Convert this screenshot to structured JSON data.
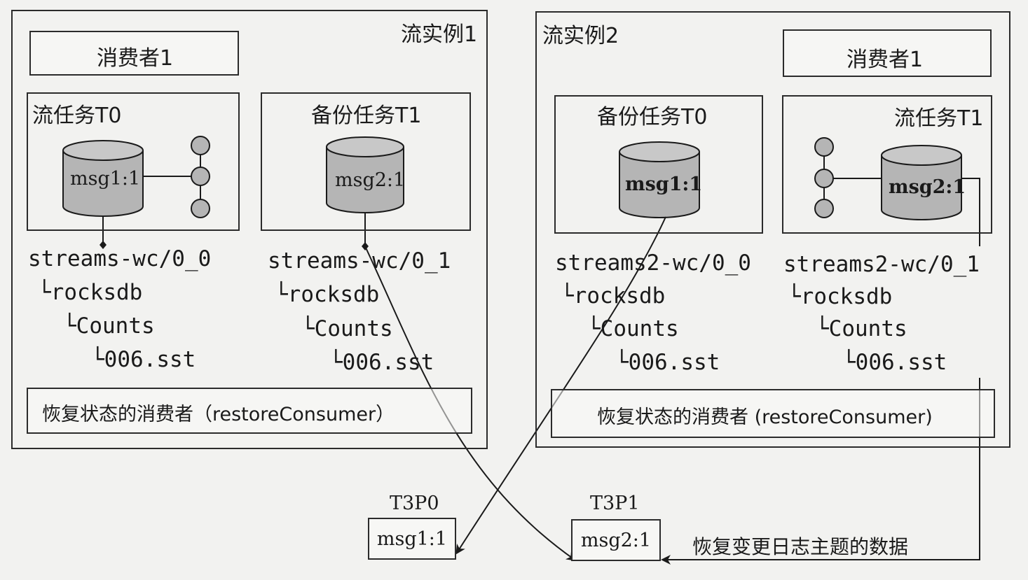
{
  "instance1": {
    "title": "流实例1",
    "consumer": "消费者1",
    "task_a": {
      "title": "流任务T0",
      "store": "msg1:1"
    },
    "task_b": {
      "title": "备份任务T1",
      "store": "msg2:1"
    },
    "dir_a": [
      "streams-wc/0_0",
      "└rocksdb",
      "└Counts",
      "└006.sst"
    ],
    "dir_b": [
      "streams-wc/0_1",
      "└rocksdb",
      "└Counts",
      "└006.sst"
    ],
    "restore": "恢复状态的消费者（restoreConsumer）"
  },
  "instance2": {
    "title": "流实例2",
    "consumer": "消费者1",
    "task_a": {
      "title": "备份任务T0",
      "store": "msg1:1"
    },
    "task_b": {
      "title": "流任务T1",
      "store": "msg2:1"
    },
    "dir_a": [
      "streams2-wc/0_0",
      "└rocksdb",
      "└Counts",
      "└006.sst"
    ],
    "dir_b": [
      "streams2-wc/0_1",
      "└rocksdb",
      "└Counts",
      "└006.sst"
    ],
    "restore": "恢复状态的消费者 (restoreConsumer)"
  },
  "topics": [
    {
      "name": "T3P0",
      "value": "msg1:1"
    },
    {
      "name": "T3P1",
      "value": "msg2:1"
    }
  ],
  "changelog_label": "恢复变更日志主题的数据",
  "colors": {
    "cylinder": "#b5b5b5",
    "line": "#1a1a1a"
  }
}
